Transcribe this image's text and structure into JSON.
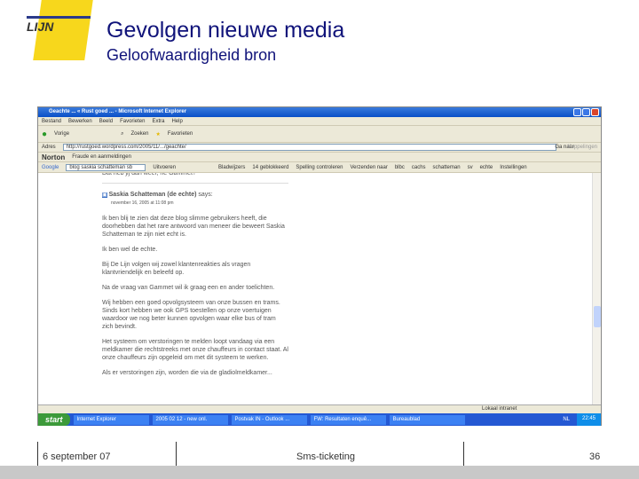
{
  "slide": {
    "title": "Gevolgen nieuwe media",
    "subtitle": "Geloofwaardigheid bron",
    "logo_text": "LIJN"
  },
  "browser": {
    "window_title": "Geachte ... « Rust goed ... - Microsoft Internet Explorer",
    "menu": [
      "Bestand",
      "Bewerken",
      "Beeld",
      "Favorieten",
      "Extra",
      "Help"
    ],
    "toolbar": [
      "Vorige",
      "Zoeken",
      "Favorieten"
    ],
    "address_label": "Adres",
    "address": "http://rustgoed.wordpress.com/2005/11/.../geachte/",
    "go_label": "Ga naar",
    "links_label": "Koppelingen",
    "norton": {
      "label": "Norton",
      "item": "Fraude en aanmeldingen"
    },
    "google": {
      "label": "Google",
      "search": "blog saskia schatteman sb",
      "items": [
        "Uitvoeren",
        "Bladwijzers",
        "14 geblokkeerd",
        "Spelling controleren",
        "Verzenden naar",
        "blbc",
        "cachs",
        "schatteman",
        "sv",
        "echte",
        "Instellingen"
      ]
    },
    "post": {
      "prev_line": "Dat heb jij dan weer, he Gammet?",
      "author": "Saskia Schatteman (de echte)",
      "says": "says:",
      "date": "november 16, 2005 at 11:08 pm",
      "paragraphs": [
        "Ik ben blij te zien dat deze blog slimme gebruikers heeft, die doorhebben dat het rare antwoord van meneer die beweert Saskia Schatteman te zijn niet echt is.",
        "Ik ben wel de echte.",
        "Bij De Lijn volgen wij zowel klantenreakties als vragen klantvriendelijk en beleefd op.",
        "Na de vraag van Gammet wil ik graag een en ander toelichten.",
        "Wij hebben een goed opvolgsysteem van onze bussen en trams. Sinds kort hebben we ook GPS toestellen op onze voertuigen waardoor we nog beter kunnen opvolgen waar elke bus of tram zich bevindt.",
        "Het systeem om verstoringen te melden loopt vandaag via een meldkamer die rechtstreeks met onze chauffeurs in contact staat. Al onze chauffeurs zijn opgeleid om met dit systeem te werken.",
        "Als er verstoringen zijn, worden die via de gladiolmeldkamer..."
      ]
    },
    "status_zone": "Lokaal intranet",
    "taskbar": {
      "start": "start",
      "tasks": [
        "Internet Explorer",
        "2005 02 12 - new onl.",
        "Postvak IN - Outlook ...",
        "FW: Resultaten enquê...",
        "Bureaublad"
      ],
      "lang": "NL",
      "clock": "22:45"
    }
  },
  "footer": {
    "date": "6 september 07",
    "center": "Sms-ticketing",
    "page": "36"
  }
}
